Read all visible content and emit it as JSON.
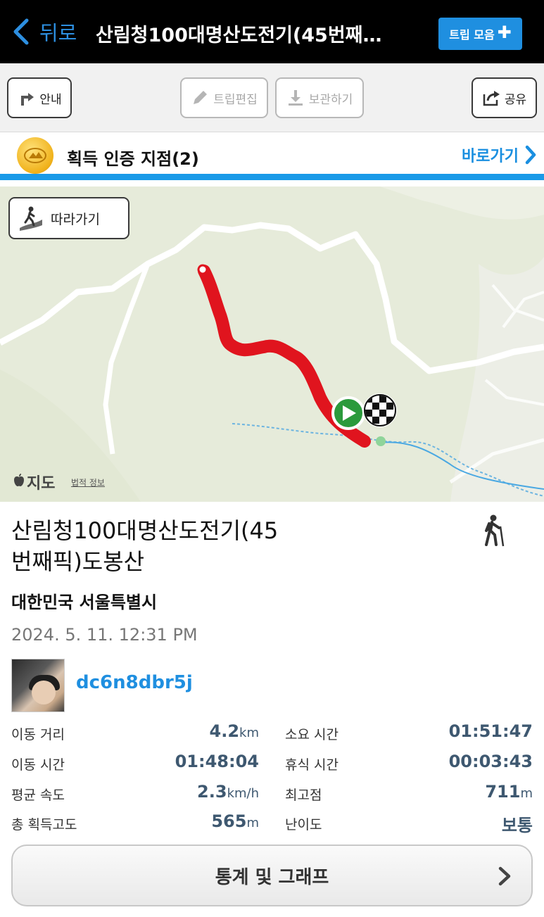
{
  "header": {
    "back_label": "뒤로",
    "title": "산림청100대명산도전기(45번째…",
    "trip_collection_label": "트립 모음"
  },
  "toolbar": {
    "guide_label": "안내",
    "edit_label": "트립편집",
    "save_label": "보관하기",
    "share_label": "공유"
  },
  "badges": {
    "title": "획득 인증 지점(2)",
    "shortcut_label": "바로가기"
  },
  "map": {
    "follow_label": "따라가기",
    "provider_label": "지도",
    "legal_label": "법적 정보",
    "route_color": "#e0141e"
  },
  "trip": {
    "title": "산림청100대명산도전기(45번째픽)도봉산",
    "title_line1": "산림청100대명산도전기(45",
    "title_line2": "번째픽)도봉산",
    "region": "대한민국 서울특별시",
    "datetime": "2024. 5. 11. 12:31 PM",
    "username": "dc6n8dbr5j",
    "activity_icon": "hiker-icon"
  },
  "stats": [
    {
      "label": "이동 거리",
      "value": "4.2",
      "unit": "km"
    },
    {
      "label": "소요 시간",
      "value": "01:51:47",
      "unit": ""
    },
    {
      "label": "이동 시간",
      "value": "01:48:04",
      "unit": ""
    },
    {
      "label": "휴식 시간",
      "value": "00:03:43",
      "unit": ""
    },
    {
      "label": "평균 속도",
      "value": "2.3",
      "unit": "km/h"
    },
    {
      "label": "최고점",
      "value": "711",
      "unit": "m"
    },
    {
      "label": "총 획득고도",
      "value": "565",
      "unit": "m"
    },
    {
      "label": "난이도",
      "value": "보통",
      "unit": ""
    }
  ],
  "stats_button_label": "통계 및 그래프",
  "colors": {
    "accent": "#1f8fe0",
    "header_bg": "#000000",
    "value_text": "#3e5870"
  }
}
